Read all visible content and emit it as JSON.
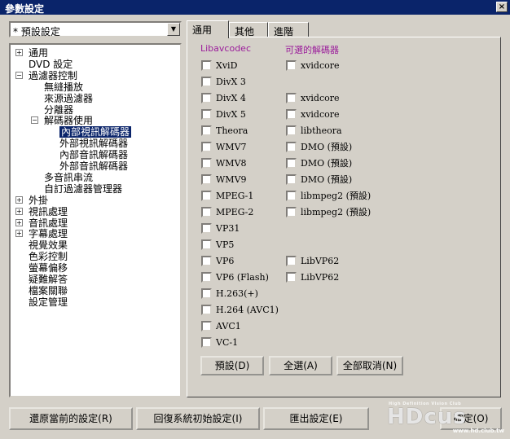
{
  "window": {
    "title": "參數設定",
    "close_label": "×"
  },
  "profile": {
    "value": "* 預設設定"
  },
  "tree": {
    "items": [
      {
        "label": "通用",
        "expander": "+"
      },
      {
        "label": "DVD 設定",
        "expander": ""
      },
      {
        "label": "過濾器控制",
        "expander": "−"
      },
      {
        "label": "無縫播放",
        "expander": ""
      },
      {
        "label": "來源過濾器",
        "expander": ""
      },
      {
        "label": "分離器",
        "expander": ""
      },
      {
        "label": "解碼器使用",
        "expander": "−"
      },
      {
        "label": "內部視訊解碼器",
        "expander": ""
      },
      {
        "label": "外部視訊解碼器",
        "expander": ""
      },
      {
        "label": "內部音訊解碼器",
        "expander": ""
      },
      {
        "label": "外部音訊解碼器",
        "expander": ""
      },
      {
        "label": "多音訊串流",
        "expander": ""
      },
      {
        "label": "自訂過濾器管理器",
        "expander": ""
      },
      {
        "label": "外掛",
        "expander": "+"
      },
      {
        "label": "視訊處理",
        "expander": "+"
      },
      {
        "label": "音訊處理",
        "expander": "+"
      },
      {
        "label": "字幕處理",
        "expander": "+"
      },
      {
        "label": "視覺效果",
        "expander": ""
      },
      {
        "label": "色彩控制",
        "expander": ""
      },
      {
        "label": "螢幕偏移",
        "expander": ""
      },
      {
        "label": "疑難解答",
        "expander": ""
      },
      {
        "label": "檔案關聯",
        "expander": ""
      },
      {
        "label": "設定管理",
        "expander": ""
      }
    ]
  },
  "tabs": [
    {
      "label": "通用"
    },
    {
      "label": "其他"
    },
    {
      "label": "進階"
    }
  ],
  "panel": {
    "col1_header": "Libavcodec",
    "col2_header": "可選的解碼器",
    "codecs": [
      "XviD",
      "DivX 3",
      "DivX 4",
      "DivX 5",
      "Theora",
      "WMV7",
      "WMV8",
      "WMV9",
      "MPEG-1",
      "MPEG-2",
      "VP31",
      "VP5",
      "VP6",
      "VP6 (Flash)",
      "H.263(+)",
      "H.264 (AVC1)",
      "AVC1",
      "VC-1"
    ],
    "alt": [
      "xvidcore",
      "",
      "xvidcore",
      "xvidcore",
      "libtheora",
      "DMO (預設)",
      "DMO (預設)",
      "DMO (預設)",
      "libmpeg2 (預設)",
      "libmpeg2 (預設)",
      "",
      "",
      "LibVP62",
      "LibVP62",
      "",
      "",
      "",
      ""
    ],
    "buttons": {
      "default": "預設(D)",
      "select_all": "全選(A)",
      "deselect_all": "全部取消(N)"
    }
  },
  "footer": {
    "restore": "還原當前的設定(R)",
    "reset": "回復系統初始設定(I)",
    "export": "匯出設定(E)",
    "ok": "確定(O)"
  },
  "watermark": {
    "small": "High Definition Vision Club",
    "big": "HDcus",
    "url": "www.hd.club.tw"
  }
}
